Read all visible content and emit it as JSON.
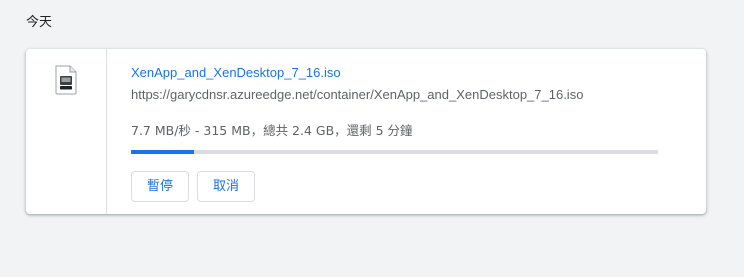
{
  "section": {
    "heading": "今天"
  },
  "download": {
    "icon": "disc-image-file-icon",
    "file_name": "XenApp_and_XenDesktop_7_16.iso",
    "url": "https://garycdnsr.azureedge.net/container/XenApp_and_XenDesktop_7_16.iso",
    "status": "7.7 MB/秒 - 315 MB，總共 2.4 GB，還剩 5 分鐘",
    "progress_fraction": 0.12,
    "buttons": {
      "pause_label": "暫停",
      "cancel_label": "取消"
    }
  },
  "colors": {
    "accent": "#1a73e8",
    "background": "#f1f3f4"
  }
}
